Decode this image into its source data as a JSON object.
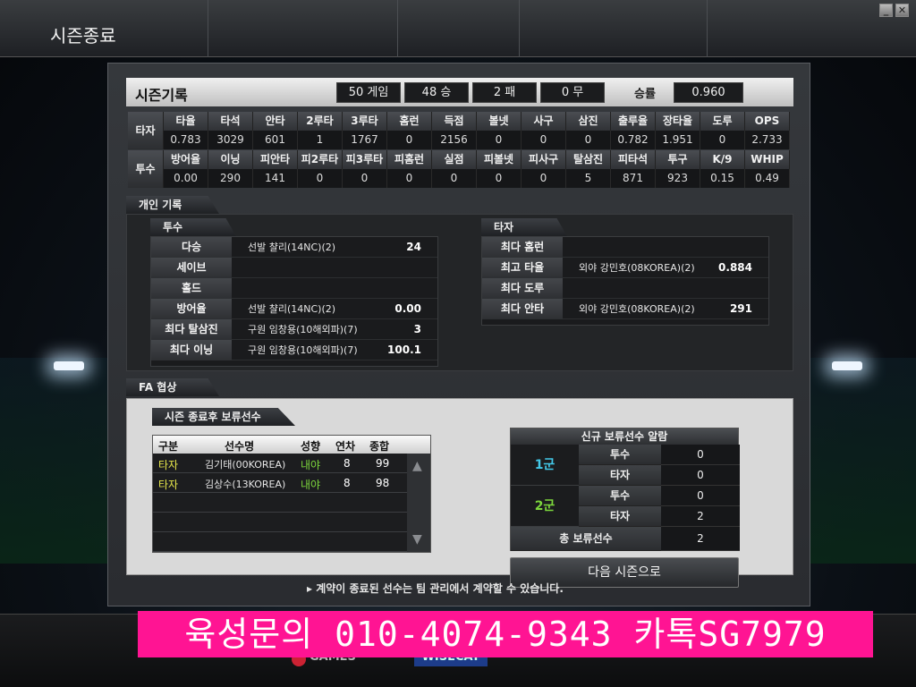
{
  "window": {
    "title": "시즌종료",
    "minimize": "_",
    "close": "✕"
  },
  "record": {
    "label": "시즌기록",
    "games": "50 게임",
    "wins": "48  승",
    "losses": "2  패",
    "draws": "0  무",
    "win_rate_label": "승률",
    "win_rate": "0.960"
  },
  "batting": {
    "side": "타자",
    "headers": [
      "타율",
      "타석",
      "안타",
      "2루타",
      "3루타",
      "홈런",
      "득점",
      "볼넷",
      "사구",
      "삼진",
      "출루율",
      "장타율",
      "도루",
      "OPS"
    ],
    "values": [
      "0.783",
      "3029",
      "601",
      "1",
      "1767",
      "0",
      "2156",
      "0",
      "0",
      "0",
      "0.782",
      "1.951",
      "0",
      "2.733"
    ]
  },
  "pitching": {
    "side": "투수",
    "headers": [
      "방어율",
      "이닝",
      "피안타",
      "피2루타",
      "피3루타",
      "피홈런",
      "실점",
      "피볼넷",
      "피사구",
      "탈삼진",
      "피타석",
      "투구",
      "K/9",
      "WHIP"
    ],
    "values": [
      "0.00",
      "290",
      "141",
      "0",
      "0",
      "0",
      "0",
      "0",
      "0",
      "5",
      "871",
      "923",
      "0.15",
      "0.49"
    ]
  },
  "personal": {
    "tab": "개인 기록",
    "pitcher_tab": "투수",
    "pitcher_rows": [
      {
        "key": "다승",
        "name": "선발 챨리(14NC)(2)",
        "value": "24"
      },
      {
        "key": "세이브",
        "name": "",
        "value": ""
      },
      {
        "key": "홀드",
        "name": "",
        "value": ""
      },
      {
        "key": "방어율",
        "name": "선발 챨리(14NC)(2)",
        "value": "0.00"
      },
      {
        "key": "최다 탈삼진",
        "name": "구원 임창용(10해외파)(7)",
        "value": "3"
      },
      {
        "key": "최다 이닝",
        "name": "구원 임창용(10해외파)(7)",
        "value": "100.1"
      }
    ],
    "batter_tab": "타자",
    "batter_rows": [
      {
        "key": "최다 홈런",
        "name": "",
        "value": ""
      },
      {
        "key": "최고 타율",
        "name": "외야 강민호(08KOREA)(2)",
        "value": "0.884"
      },
      {
        "key": "최다 도루",
        "name": "",
        "value": ""
      },
      {
        "key": "최다 안타",
        "name": "외야 강민호(08KOREA)(2)",
        "value": "291"
      }
    ]
  },
  "fa": {
    "tab": "FA 협상",
    "list_tab": "시즌 종료후 보류선수",
    "columns": [
      "구분",
      "선수명",
      "성향",
      "연차",
      "종합"
    ],
    "rows": [
      {
        "type": "타자",
        "name": "김기태(00KOREA)",
        "tendency": "내야",
        "year": "8",
        "total": "99"
      },
      {
        "type": "타자",
        "name": "김상수(13KOREA)",
        "tendency": "내야",
        "year": "8",
        "total": "98"
      }
    ],
    "alarm_title": "신규 보류선수 알람",
    "group1": "1군",
    "group2": "2군",
    "pitcher": "투수",
    "batter": "타자",
    "g1_pitcher": "0",
    "g1_batter": "0",
    "g2_pitcher": "0",
    "g2_batter": "2",
    "total_label": "총 보류선수",
    "total": "2",
    "next_button": "다음 시즌으로"
  },
  "note": "▸ 계약이 종료된 선수는 팀 관리에서 계약할 수 있습니다.",
  "footer": {
    "games": "GAMES",
    "wisecat": "WISECAT"
  },
  "promo": "육성문의 010-4074-9343 카톡SG7979",
  "colors": {
    "accent_yellow": "#e8e84a",
    "accent_green": "#7cd63c",
    "accent_cyan": "#43c8e8",
    "promo_pink": "#ff1493"
  }
}
